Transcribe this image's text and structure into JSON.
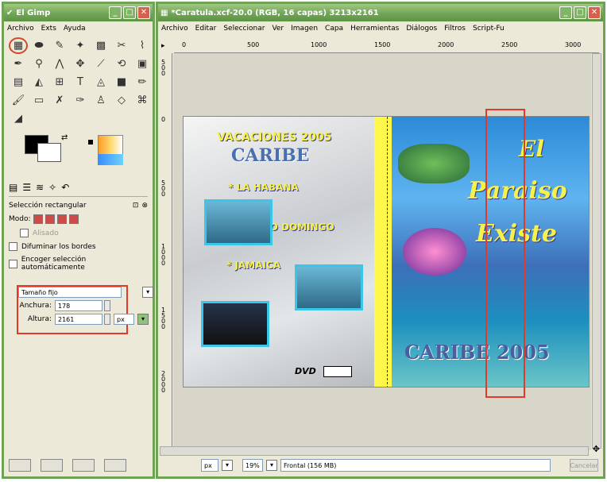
{
  "toolbox": {
    "title": "El Gimp",
    "menu": [
      "Archivo",
      "Exts",
      "Ayuda"
    ],
    "tool_options": {
      "title": "Selección rectangular",
      "mode_label": "Modo:",
      "aliased": "Alisado",
      "feather": "Difuminar los bordes",
      "shrink": "Encoger selección automáticamente",
      "fixed": "Tamaño fijo",
      "width_label": "Anchura:",
      "width_value": "178",
      "height_label": "Altura:",
      "height_value": "2161",
      "unit": "px"
    }
  },
  "image_window": {
    "title": "*Caratula.xcf-20.0 (RGB, 16 capas) 3213x2161",
    "menu": [
      "Archivo",
      "Editar",
      "Seleccionar",
      "Ver",
      "Imagen",
      "Capa",
      "Herramientas",
      "Diálogos",
      "Filtros",
      "Script-Fu"
    ],
    "ruler_top": [
      "0",
      "500",
      "1000",
      "1500",
      "2000",
      "2500",
      "3000"
    ],
    "ruler_left": [
      "500",
      "0",
      "500",
      "1000",
      "1500",
      "2000"
    ],
    "status": {
      "unit": "px",
      "zoom": "19%",
      "layer": "Frontal (156 MB)",
      "cancel": "Cancelar"
    }
  },
  "cover": {
    "left": {
      "heading": "VACACIONES 2005",
      "subheading": "CARIBE",
      "item1": "* LA HABANA",
      "item2": "* SANTO DOMINGO",
      "item3": "* JAMAICA",
      "dvd": "DVD"
    },
    "right": {
      "line1": "El",
      "line2": "Paraiso",
      "line3": "Existe",
      "footer": "CARIBE 2005"
    }
  }
}
